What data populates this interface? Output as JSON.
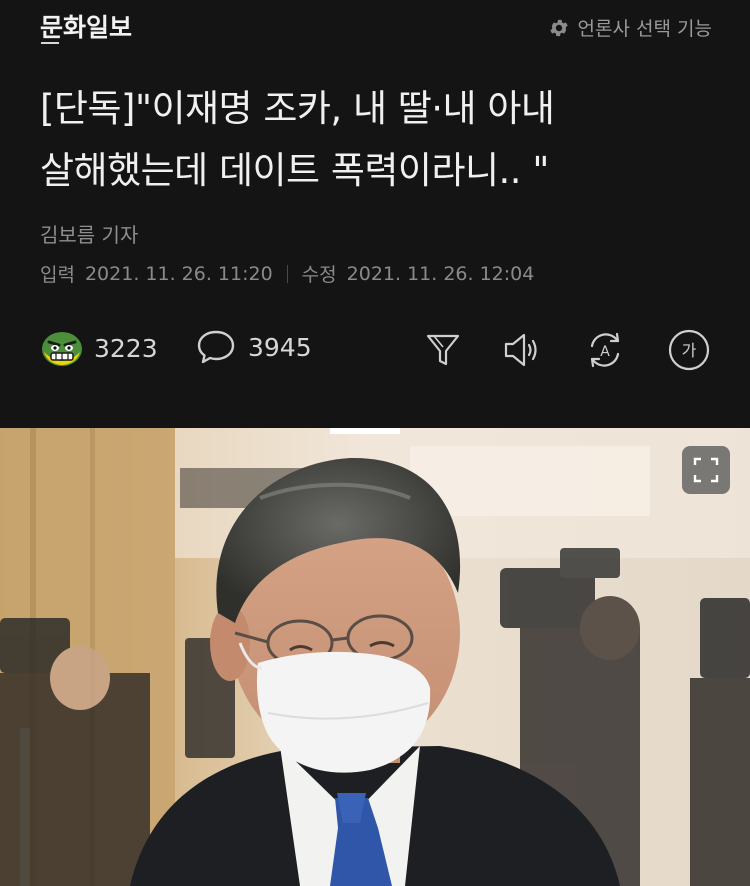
{
  "header": {
    "logo_text": "문화일보",
    "press_select_label": "언론사 선택 기능",
    "press_select_icon": "gear-icon"
  },
  "article": {
    "headline_line1": "[단독]\"이재명 조카, 내 딸·내 아내",
    "headline_line2": "살해했는데 데이트 폭력이라니.. \"",
    "reporter": "김보름 기자",
    "input_label": "입력",
    "input_date": "2021. 11. 26. 11:20",
    "modified_label": "수정",
    "modified_date": "2021. 11. 26. 12:04"
  },
  "actions": {
    "reaction_count": "3223",
    "reaction_icon": "angry-face-icon",
    "comment_count": "3945",
    "comment_icon": "speech-bubble-icon",
    "tools": [
      "summary-funnel-icon",
      "speaker-icon",
      "translate-icon",
      "font-size-icon"
    ],
    "font_size_glyph": "가",
    "translate_glyph": "A"
  },
  "colors": {
    "background": "#141414",
    "text_primary": "#f0f0f0",
    "text_secondary": "#8a8a8a",
    "reaction_face": "#4b8f3a"
  }
}
